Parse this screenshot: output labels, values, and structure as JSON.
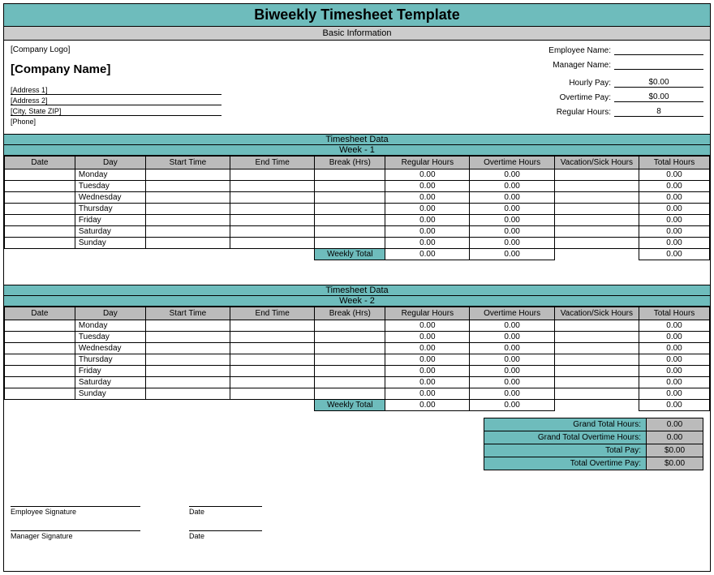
{
  "title": "Biweekly Timesheet Template",
  "section_basic": "Basic Information",
  "logo": "[Company Logo]",
  "company": "[Company Name]",
  "addr1": "[Address 1]",
  "addr2": "[Address 2]",
  "city": "[City, State ZIP]",
  "phone": "[Phone]",
  "fields": {
    "emp_name_lbl": "Employee Name:",
    "emp_name_val": "",
    "mgr_name_lbl": "Manager Name:",
    "mgr_name_val": "",
    "hourly_lbl": "Hourly Pay:",
    "hourly_val": "$0.00",
    "ot_lbl": "Overtime Pay:",
    "ot_val": "$0.00",
    "reg_lbl": "Regular Hours:",
    "reg_val": "8"
  },
  "ts_header": "Timesheet Data",
  "week1": "Week - 1",
  "week2": "Week - 2",
  "cols": {
    "date": "Date",
    "day": "Day",
    "start": "Start Time",
    "end": "End Time",
    "break": "Break (Hrs)",
    "reg": "Regular Hours",
    "ot": "Overtime Hours",
    "vac": "Vacation/Sick Hours",
    "total": "Total Hours"
  },
  "days": {
    "mon": "Monday",
    "tue": "Tuesday",
    "wed": "Wednesday",
    "thu": "Thursday",
    "fri": "Friday",
    "sat": "Saturday",
    "sun": "Sunday"
  },
  "zero": "0.00",
  "weekly_total": "Weekly Total",
  "totals": {
    "gth_lbl": "Grand Total Hours:",
    "gth_val": "0.00",
    "gtoh_lbl": "Grand Total Overtime Hours:",
    "gtoh_val": "0.00",
    "tp_lbl": "Total Pay:",
    "tp_val": "$0.00",
    "top_lbl": "Total Overtime Pay:",
    "top_val": "$0.00"
  },
  "sig": {
    "emp": "Employee Signature",
    "mgr": "Manager Signature",
    "date": "Date"
  }
}
